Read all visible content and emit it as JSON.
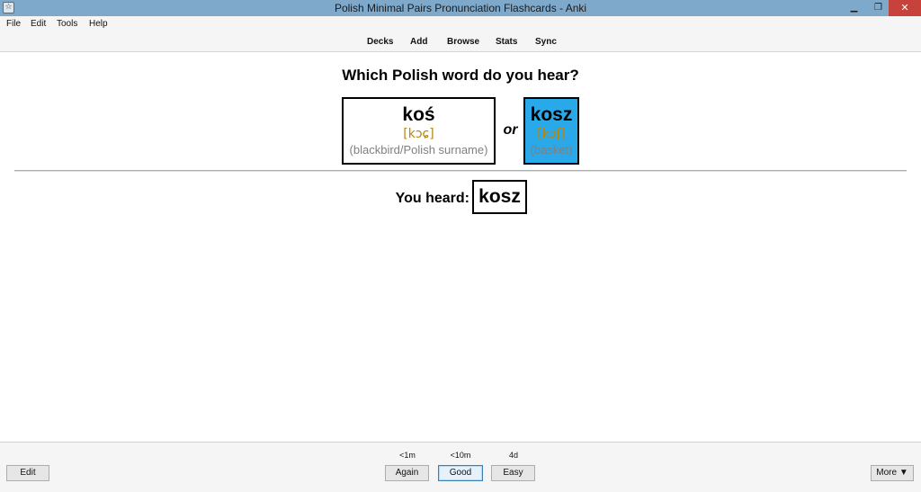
{
  "window": {
    "title": "Polish Minimal Pairs Pronunciation Flashcards - Anki",
    "app_icon": "anki-icon",
    "controls": {
      "minimize": "▁",
      "maximize": "❐",
      "close": "✕"
    }
  },
  "menu": {
    "items": [
      "File",
      "Edit",
      "Tools",
      "Help"
    ]
  },
  "toolbar": {
    "links": [
      "Decks",
      "Add",
      "Browse",
      "Stats",
      "Sync"
    ]
  },
  "card": {
    "question": "Which Polish word do you hear?",
    "choice_a": {
      "word": "koś",
      "ipa": "[kɔɕ]",
      "gloss": "(blackbird/Polish surname)"
    },
    "or_label": "or",
    "choice_b": {
      "word": "kosz",
      "ipa": "[kɔʃ]",
      "gloss": "(basket)"
    },
    "answer_label": "You heard:",
    "answer_word": "kosz"
  },
  "colors": {
    "titlebar": "#7fa9cb",
    "highlight": "#29a8ea",
    "ipa": "#b8860b",
    "gloss": "#808080",
    "close": "#c7423a"
  },
  "bottom": {
    "edit_label": "Edit",
    "intervals": {
      "again": "<1m",
      "good": "<10m",
      "easy": "4d"
    },
    "again_label": "Again",
    "good_label": "Good",
    "easy_label": "Easy",
    "more_label": "More ▼"
  }
}
